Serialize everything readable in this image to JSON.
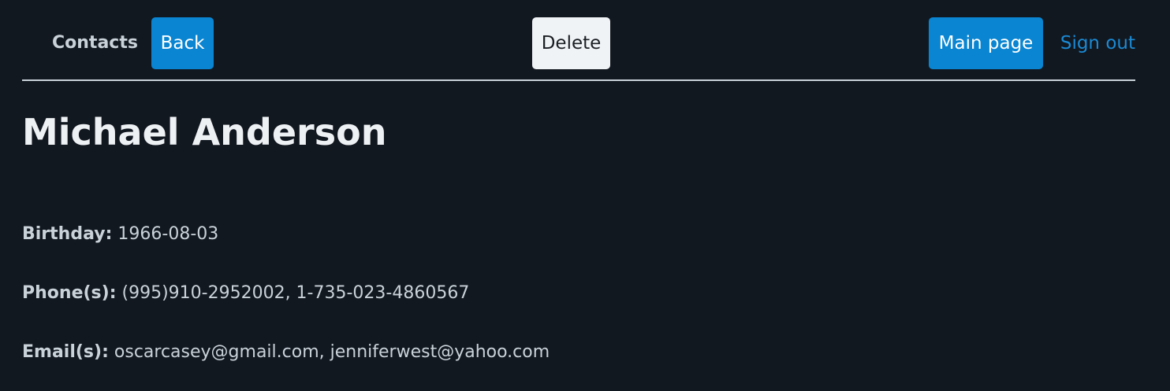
{
  "nav": {
    "brand": "Contacts",
    "back_label": "Back",
    "delete_label": "Delete",
    "main_page_label": "Main page",
    "sign_out_label": "Sign out"
  },
  "contact": {
    "name": "Michael Anderson",
    "birthday_label": "Birthday:",
    "birthday": "1966-08-03",
    "phones_label": "Phone(s):",
    "phones": "(995)910-2952002, 1-735-023-4860567",
    "emails_label": "Email(s):",
    "emails": "oscarcasey@gmail.com, jenniferwest@yahoo.com"
  },
  "colors": {
    "background": "#121820",
    "primary": "#0a85d1",
    "light_button": "#f0f3f6",
    "link": "#1a8ad4"
  }
}
